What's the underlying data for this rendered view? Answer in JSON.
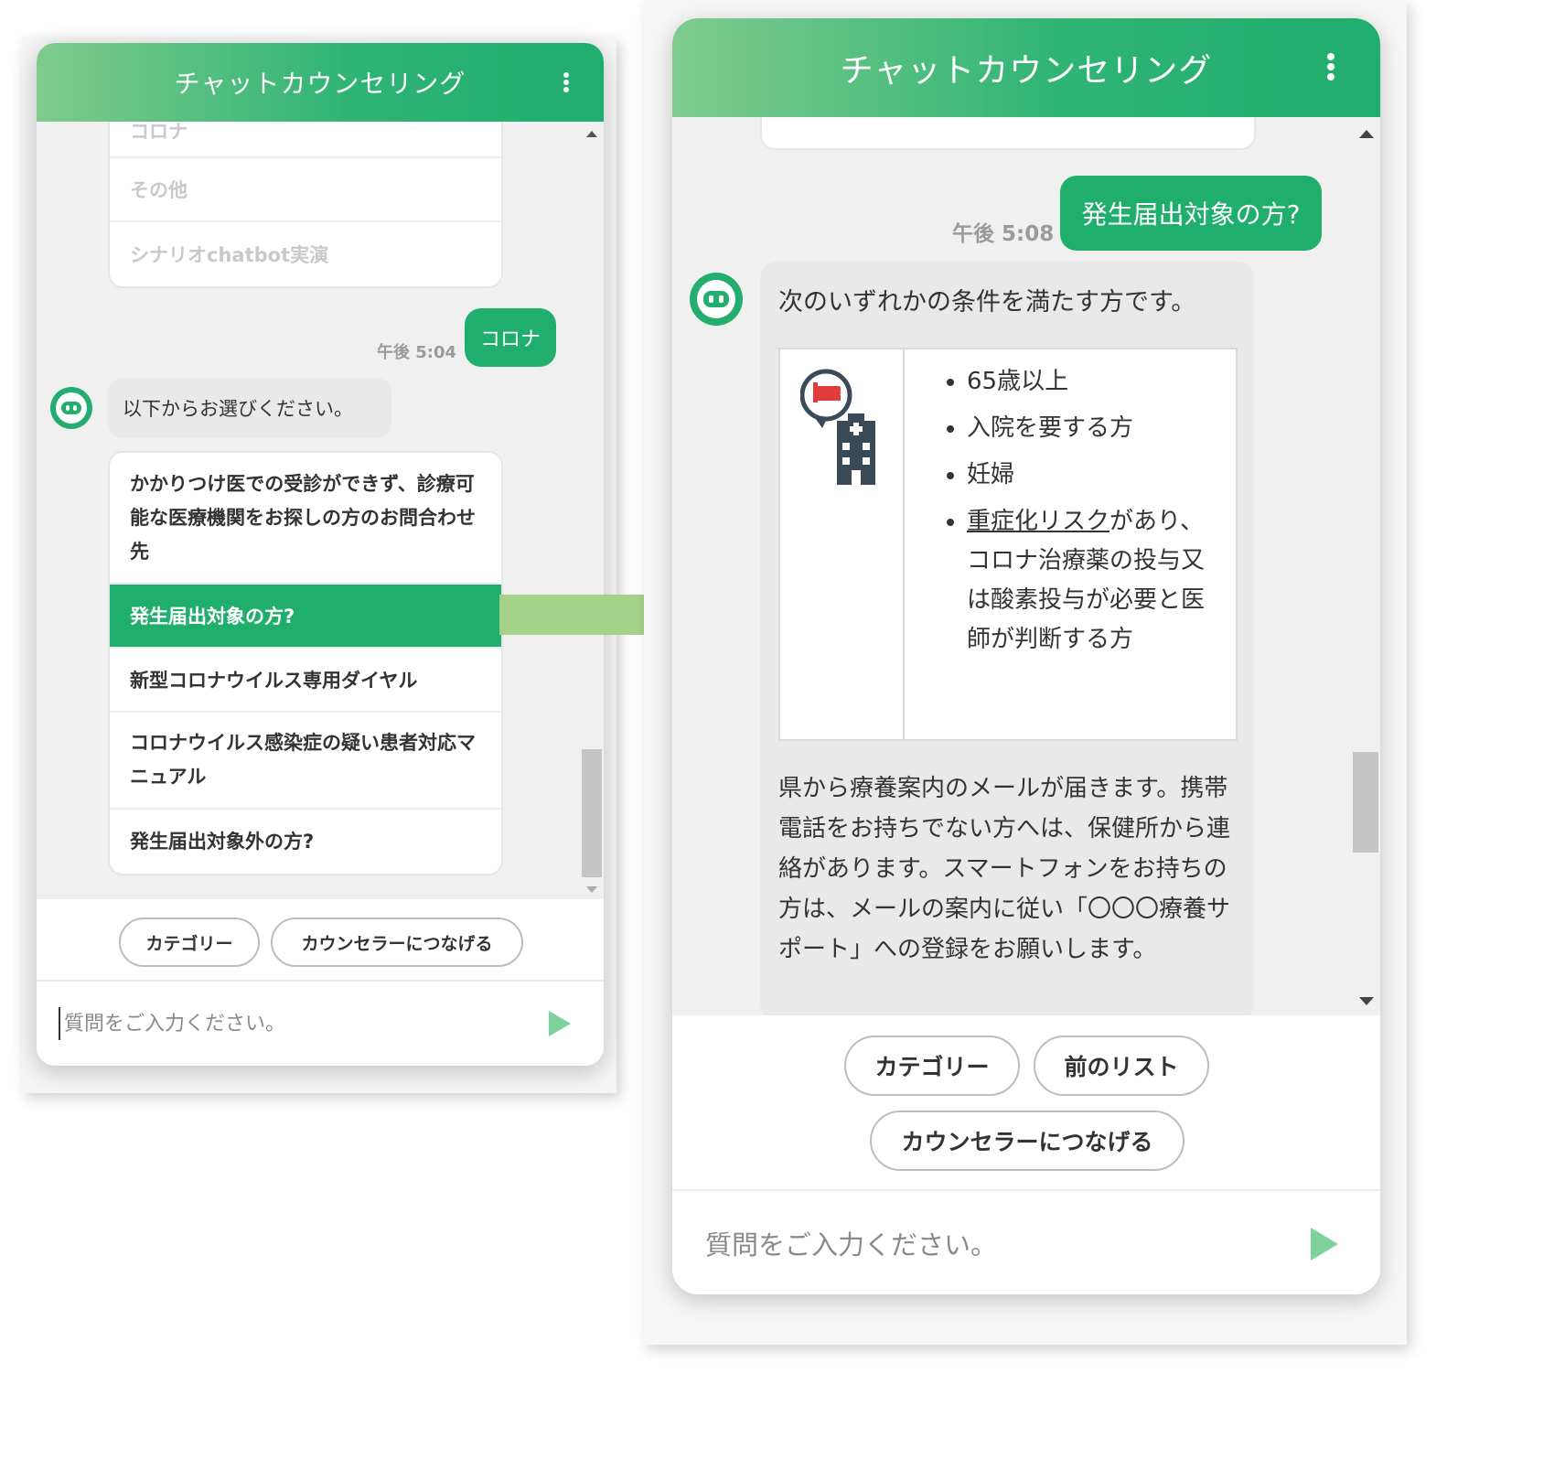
{
  "header": {
    "title": "チャットカウンセリング"
  },
  "left": {
    "options_top": [
      "コロナ",
      "その他",
      "シナリオchatbot実演"
    ],
    "user_message": "コロナ",
    "user_time": "午後 5:04",
    "bot_message": "以下からお選びください。",
    "options": [
      "かかりつけ医での受診ができず、診療可能な医療機関をお探しの方のお問合わせ先",
      "発生届出対象の方?",
      "新型コロナウイルス専用ダイヤル",
      "コロナウイルス感染症の疑い患者対応マニュアル",
      "発生届出対象外の方?"
    ],
    "quick_buttons": [
      "カテゴリー",
      "カウンセラーにつなげる"
    ],
    "input_placeholder": "質問をご入力ください。"
  },
  "right": {
    "user_message": "発生届出対象の方?",
    "user_time": "午後 5:08",
    "bot_intro": "次のいずれかの条件を満たす方です。",
    "conditions": [
      "65歳以上",
      "入院を要する方",
      "妊婦"
    ],
    "condition_link": "重症化リスク",
    "condition_link_rest": "があり、コロナ治療薬の投与又は酸素投与が必要と医師が判断する方",
    "bot_note": "県から療養案内のメールが届きます。携帯電話をお持ちでない方へは、保健所から連絡があります。スマートフォンをお持ちの方は、メールの案内に従い「〇〇〇療養サポート」への登録をお願いします。",
    "quick_buttons": [
      "カテゴリー",
      "前のリスト",
      "カウンセラーにつなげる"
    ],
    "input_placeholder": "質問をご入力ください。"
  },
  "colors": {
    "brand_green": "#1fae6c",
    "arrow_green": "#a5d28a"
  },
  "icons": [
    "kebab-menu-icon",
    "bot-avatar-icon",
    "send-icon",
    "hospital-bed-icon",
    "hospital-building-icon",
    "scroll-up-icon",
    "scroll-down-icon"
  ]
}
